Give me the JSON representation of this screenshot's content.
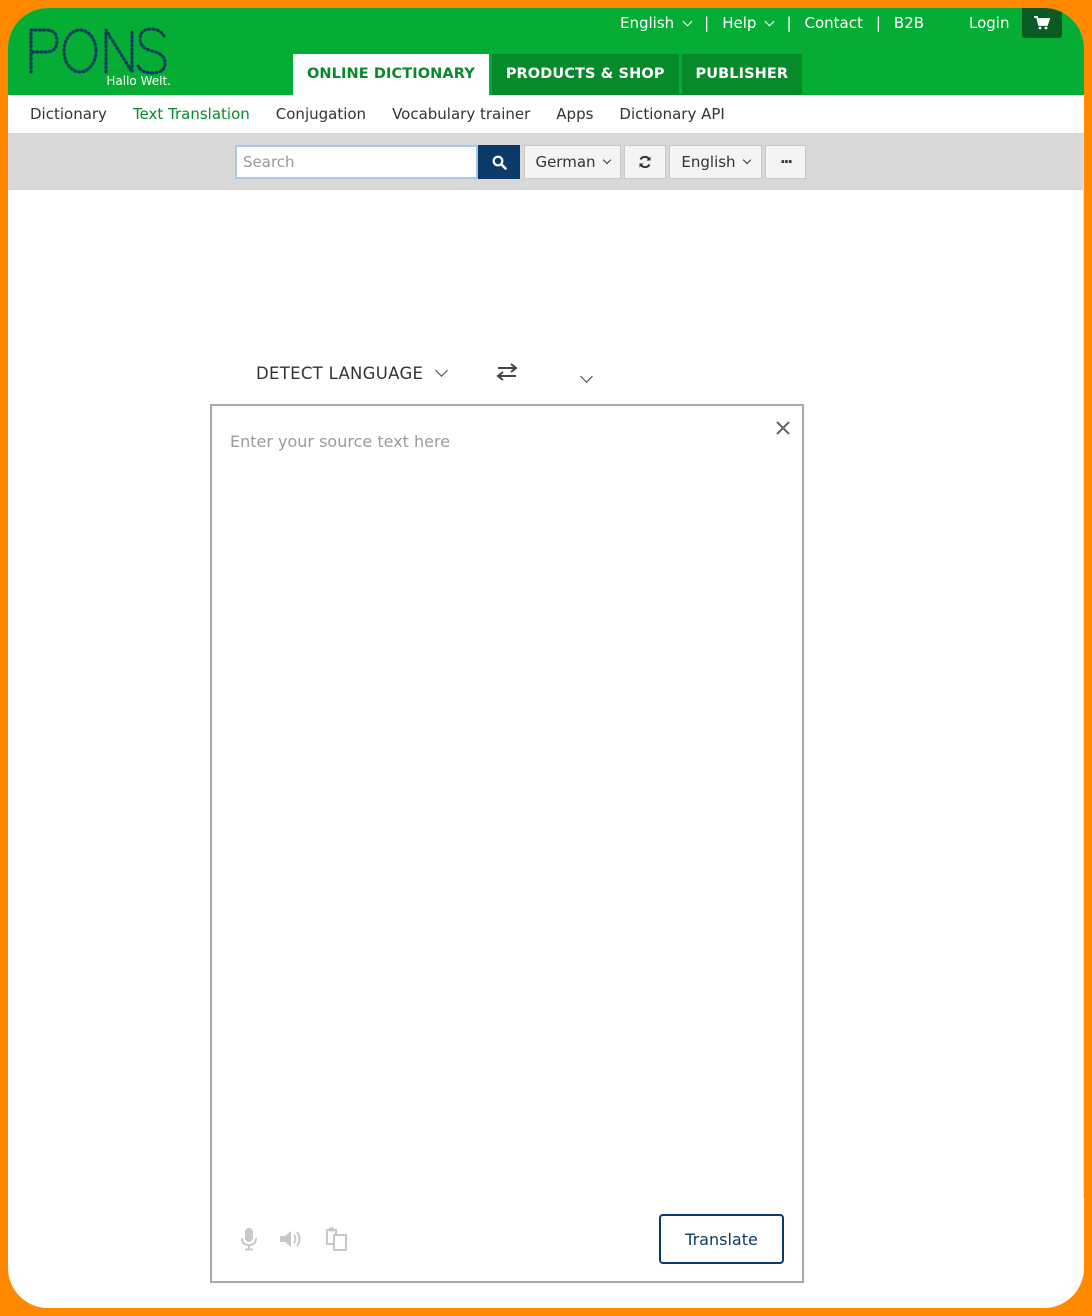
{
  "header": {
    "logo_text": "PONS",
    "logo_tagline": "Hallo Welt.",
    "util_nav": {
      "language": "English",
      "help": "Help",
      "contact": "Contact",
      "b2b": "B2B",
      "separator": "|"
    },
    "login": "Login",
    "cart_icon": "cart-icon",
    "main_tabs": [
      {
        "label": "ONLINE DICTIONARY",
        "active": true
      },
      {
        "label": "PRODUCTS & SHOP",
        "active": false
      },
      {
        "label": "PUBLISHER",
        "active": false
      }
    ]
  },
  "subnav": {
    "items": [
      {
        "label": "Dictionary",
        "active": false
      },
      {
        "label": "Text Translation",
        "active": true
      },
      {
        "label": "Conjugation",
        "active": false
      },
      {
        "label": "Vocabulary trainer",
        "active": false
      },
      {
        "label": "Apps",
        "active": false
      },
      {
        "label": "Dictionary API",
        "active": false
      }
    ]
  },
  "searchbar": {
    "placeholder": "Search",
    "value": "",
    "source_lang": "German",
    "target_lang": "English",
    "more_label": "···",
    "search_icon": "search-icon",
    "swap_icon": "refresh-icon"
  },
  "translator": {
    "source_language": "DETECT LANGUAGE",
    "target_language": "",
    "source_placeholder": "Enter your source text here",
    "translate_label": "Translate",
    "tools": [
      "microphone-icon",
      "speaker-icon",
      "copy-icon"
    ]
  },
  "colors": {
    "brand_green": "#06ad34",
    "dark_green": "#068a2a",
    "navy": "#0c3a6b",
    "frame_orange": "#ff8a00"
  }
}
